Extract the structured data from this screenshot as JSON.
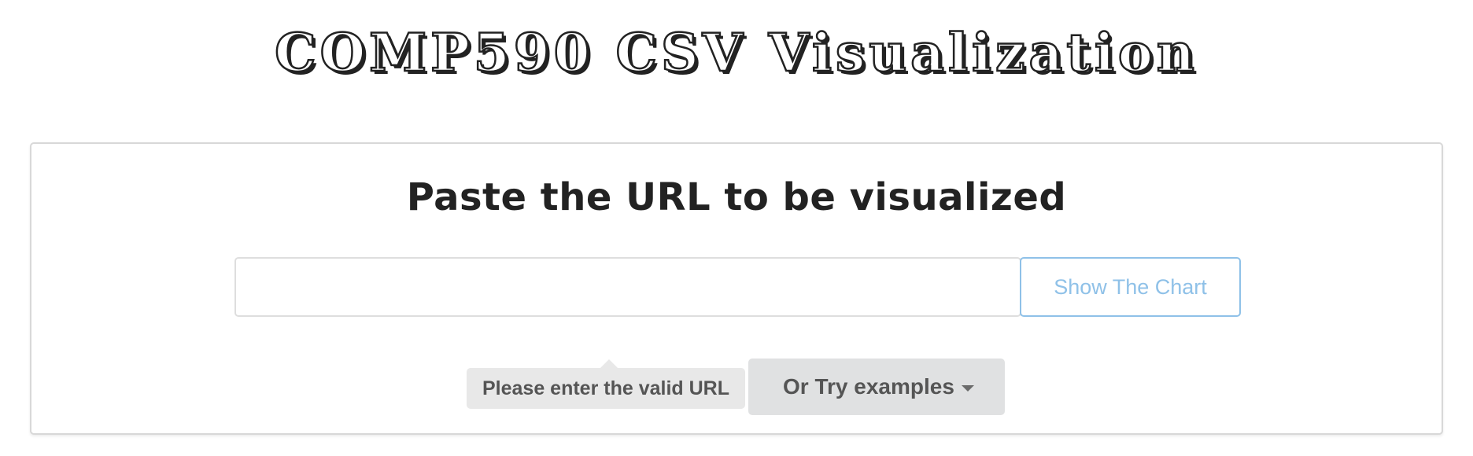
{
  "header": {
    "title": "COMP590 CSV Visualization"
  },
  "card": {
    "heading": "Paste the URL to be visualized",
    "url_input": {
      "value": "",
      "placeholder": ""
    },
    "show_chart_label": "Show The Chart",
    "validation_message": "Please enter the valid URL",
    "examples_dropdown_label": "Or Try examples",
    "examples_dropdown_icon": "chevron-down-icon"
  },
  "colors": {
    "accent_button": "#8fc1e8",
    "tooltip_background": "#e8e8e8",
    "dropdown_background": "#e0e1e2",
    "text_dark": "#222222",
    "text_muted": "#555555"
  }
}
